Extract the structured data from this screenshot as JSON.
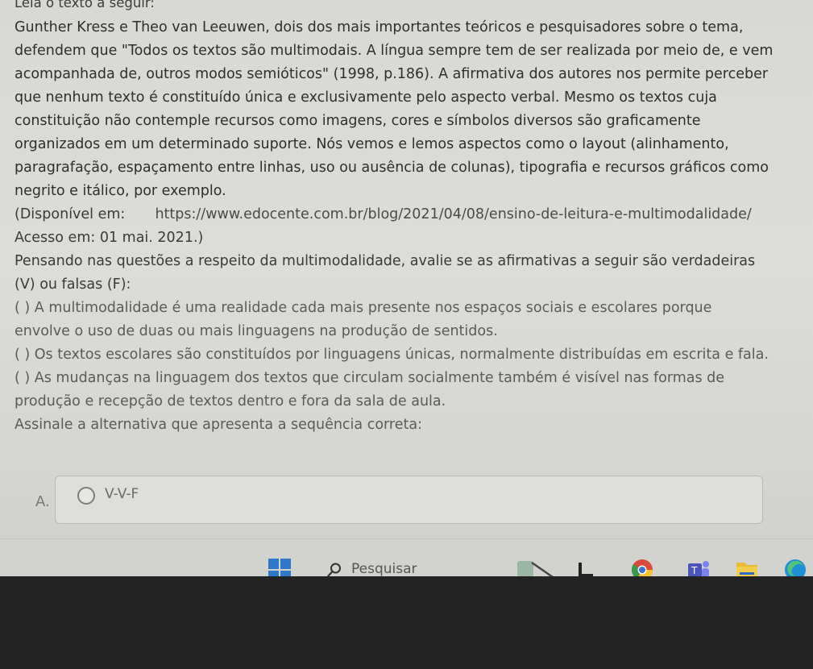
{
  "question": {
    "header": "Leia o texto a seguir:",
    "paragraph_lines": [
      "Gunther Kress e Theo van Leeuwen, dois dos mais importantes teóricos e pesquisadores sobre o tema,",
      "defendem que \"Todos os textos são multimodais. A língua sempre tem de ser realizada por meio de, e vem",
      "acompanhada de, outros modos semióticos\" (1998, p.186). A afirmativa dos autores nos permite perceber",
      "que nenhum texto é constituído única e exclusivamente pelo aspecto verbal. Mesmo os textos cuja",
      "constituição não contemple recursos como imagens, cores e símbolos diversos são graficamente",
      "organizados em um determinado suporte. Nós vemos e lemos aspectos como o layout (alinhamento,",
      "paragrafação, espaçamento entre linhas, uso ou ausência de colunas), tipografia e recursos gráficos como",
      "negrito e itálico, por exemplo."
    ],
    "source_label": "(Disponível em:",
    "source_url": "https://www.edocente.com.br/blog/2021/04/08/ensino-de-leitura-e-multimodalidade/",
    "access_line": "Acesso em: 01 mai. 2021.)",
    "instruction_lines": [
      "Pensando nas questões a respeito da multimodalidade, avalie se as afirmativas a seguir são verdadeiras",
      "(V) ou falsas (F):"
    ],
    "statement1_lines": [
      "(   ) A multimodalidade é uma realidade cada mais presente nos espaços sociais e escolares porque",
      "envolve o uso de duas ou mais linguagens na produção de sentidos."
    ],
    "statement2": "(  ) Os textos escolares são constituídos por linguagens únicas, normalmente distribuídas em escrita e fala.",
    "statement3_lines": [
      "(   ) As mudanças na linguagem dos textos que circulam socialmente também é visível nas formas de",
      "produção e recepção de textos dentro e fora da sala de aula."
    ],
    "prompt": "Assinale a alternativa que apresenta a sequência correta:"
  },
  "answer": {
    "letter": "A.",
    "text": "V-V-F"
  },
  "taskbar": {
    "search_placeholder": "Pesquisar",
    "icons": [
      "windows-start-icon",
      "search-icon",
      "widget-icon",
      "task-view-icon",
      "chrome-icon",
      "teams-icon",
      "file-explorer-icon",
      "edge-icon"
    ]
  }
}
